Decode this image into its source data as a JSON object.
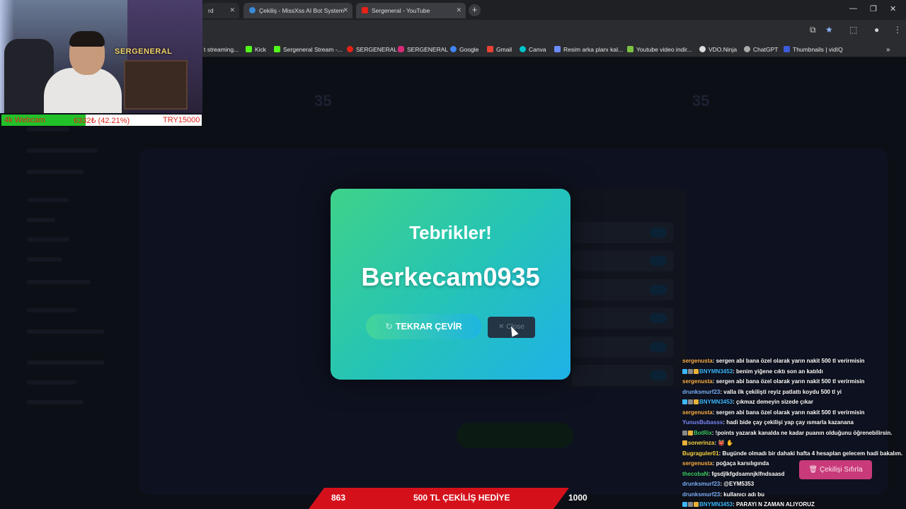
{
  "browser": {
    "tabs": [
      {
        "label": "rd",
        "active": false
      },
      {
        "label": "Çekiliş - MissXss AI Bot System",
        "active": true
      },
      {
        "label": "Sergeneral - YouTube",
        "active": false
      }
    ],
    "bookmarks": [
      "t streaming...",
      "Kick",
      "Sergeneral Stream -...",
      "SERGENERAL",
      "SERGENERAL",
      "Google",
      "Gmail",
      "Canva",
      "Resim arka planı kal...",
      "Youtube video indir...",
      "VDO.Ninja",
      "ChatGPT",
      "Thumbnails | vidIQ"
    ]
  },
  "webcam": {
    "logo_text": "SERGENERAL",
    "stat_label": "4k Webcam",
    "stat_value": "6332₺ (42.21%)",
    "stat_goal": "TRY15000",
    "progress_fraction": 0.4221
  },
  "background_app": {
    "left_stat": "35",
    "right_stat": "35"
  },
  "modal": {
    "title": "Tebrikler!",
    "winner": "Berkecam0935",
    "spin_again_label": "TEKRAR ÇEVİR",
    "close_label": "Close"
  },
  "chat": [
    {
      "user": "sergenusta",
      "color": "#ffb24a",
      "badges": 0,
      "text": ": sergen abi bana özel olarak yarın nakit 500 tl verirmisin"
    },
    {
      "user": "BNYMN3453",
      "color": "#3db8ff",
      "badges": 3,
      "text": ": benim yiğene cıktı son an katıldı"
    },
    {
      "user": "sergenusta",
      "color": "#ffb24a",
      "badges": 0,
      "text": ": sergen abi bana özel olarak yarın nakit 500 tl verirmisin"
    },
    {
      "user": "drunksmurf23",
      "color": "#7fb3ff",
      "badges": 0,
      "text": ": valla ilk çekilişti reyiz patlattı koydu 500 tl yi"
    },
    {
      "user": "BNYMN3453",
      "color": "#3db8ff",
      "badges": 3,
      "text": ": çıkmaz demeyin sizede çıkar"
    },
    {
      "user": "sergenusta",
      "color": "#ffb24a",
      "badges": 0,
      "text": ": sergen abi bana özel olarak yarın nakit 500 tl verirmisin"
    },
    {
      "user": "YunusBubasss",
      "color": "#7f8cff",
      "badges": 0,
      "text": ": hadi bide çay çekilişi yap çay ısmarla kazanana"
    },
    {
      "user": "BotRix",
      "color": "#3fd16a",
      "badges": 2,
      "text": ": !points yazarak kanalda ne kadar puanın olduğunu öğrenebilirsin."
    },
    {
      "user": "sonerinza",
      "color": "#ffd84a",
      "badges": 1,
      "text": ": 👹 ✋"
    },
    {
      "user": "Bugraguler01",
      "color": "#ffd84a",
      "badges": 0,
      "text": ": Bugünde olmadı bir dahaki hafta 4 hesaplan gelecem hadi bakalım."
    },
    {
      "user": "sergenusta",
      "color": "#ffb24a",
      "badges": 0,
      "text": ": poğaça karsılıgında"
    },
    {
      "user": "thecobaN",
      "color": "#3fd16a",
      "badges": 0,
      "text": ": fgsdjlkfgdsamnjklfndsaasd"
    },
    {
      "user": "drunksmurf23",
      "color": "#7fb3ff",
      "badges": 0,
      "text": ": @EYM5353"
    },
    {
      "user": "drunksmurf23",
      "color": "#7fb3ff",
      "badges": 0,
      "text": ": kullanıcı adı bu"
    },
    {
      "user": "BNYMN3453",
      "color": "#3db8ff",
      "badges": 3,
      "text": ": PARAYI N ZAMAN ALIYORUZ"
    }
  ],
  "reset_button": "Çekilişi Sıfırla",
  "banner": {
    "left": "863",
    "center": "500 TL ÇEKİLİŞ HEDİYE",
    "right": "1000"
  },
  "colors": {
    "modal_start": "#3fd28a",
    "modal_end": "#1fb1e8",
    "banner_red": "#d4111b",
    "progress_green": "#22c12a",
    "reset_pink": "#c93a7a"
  }
}
